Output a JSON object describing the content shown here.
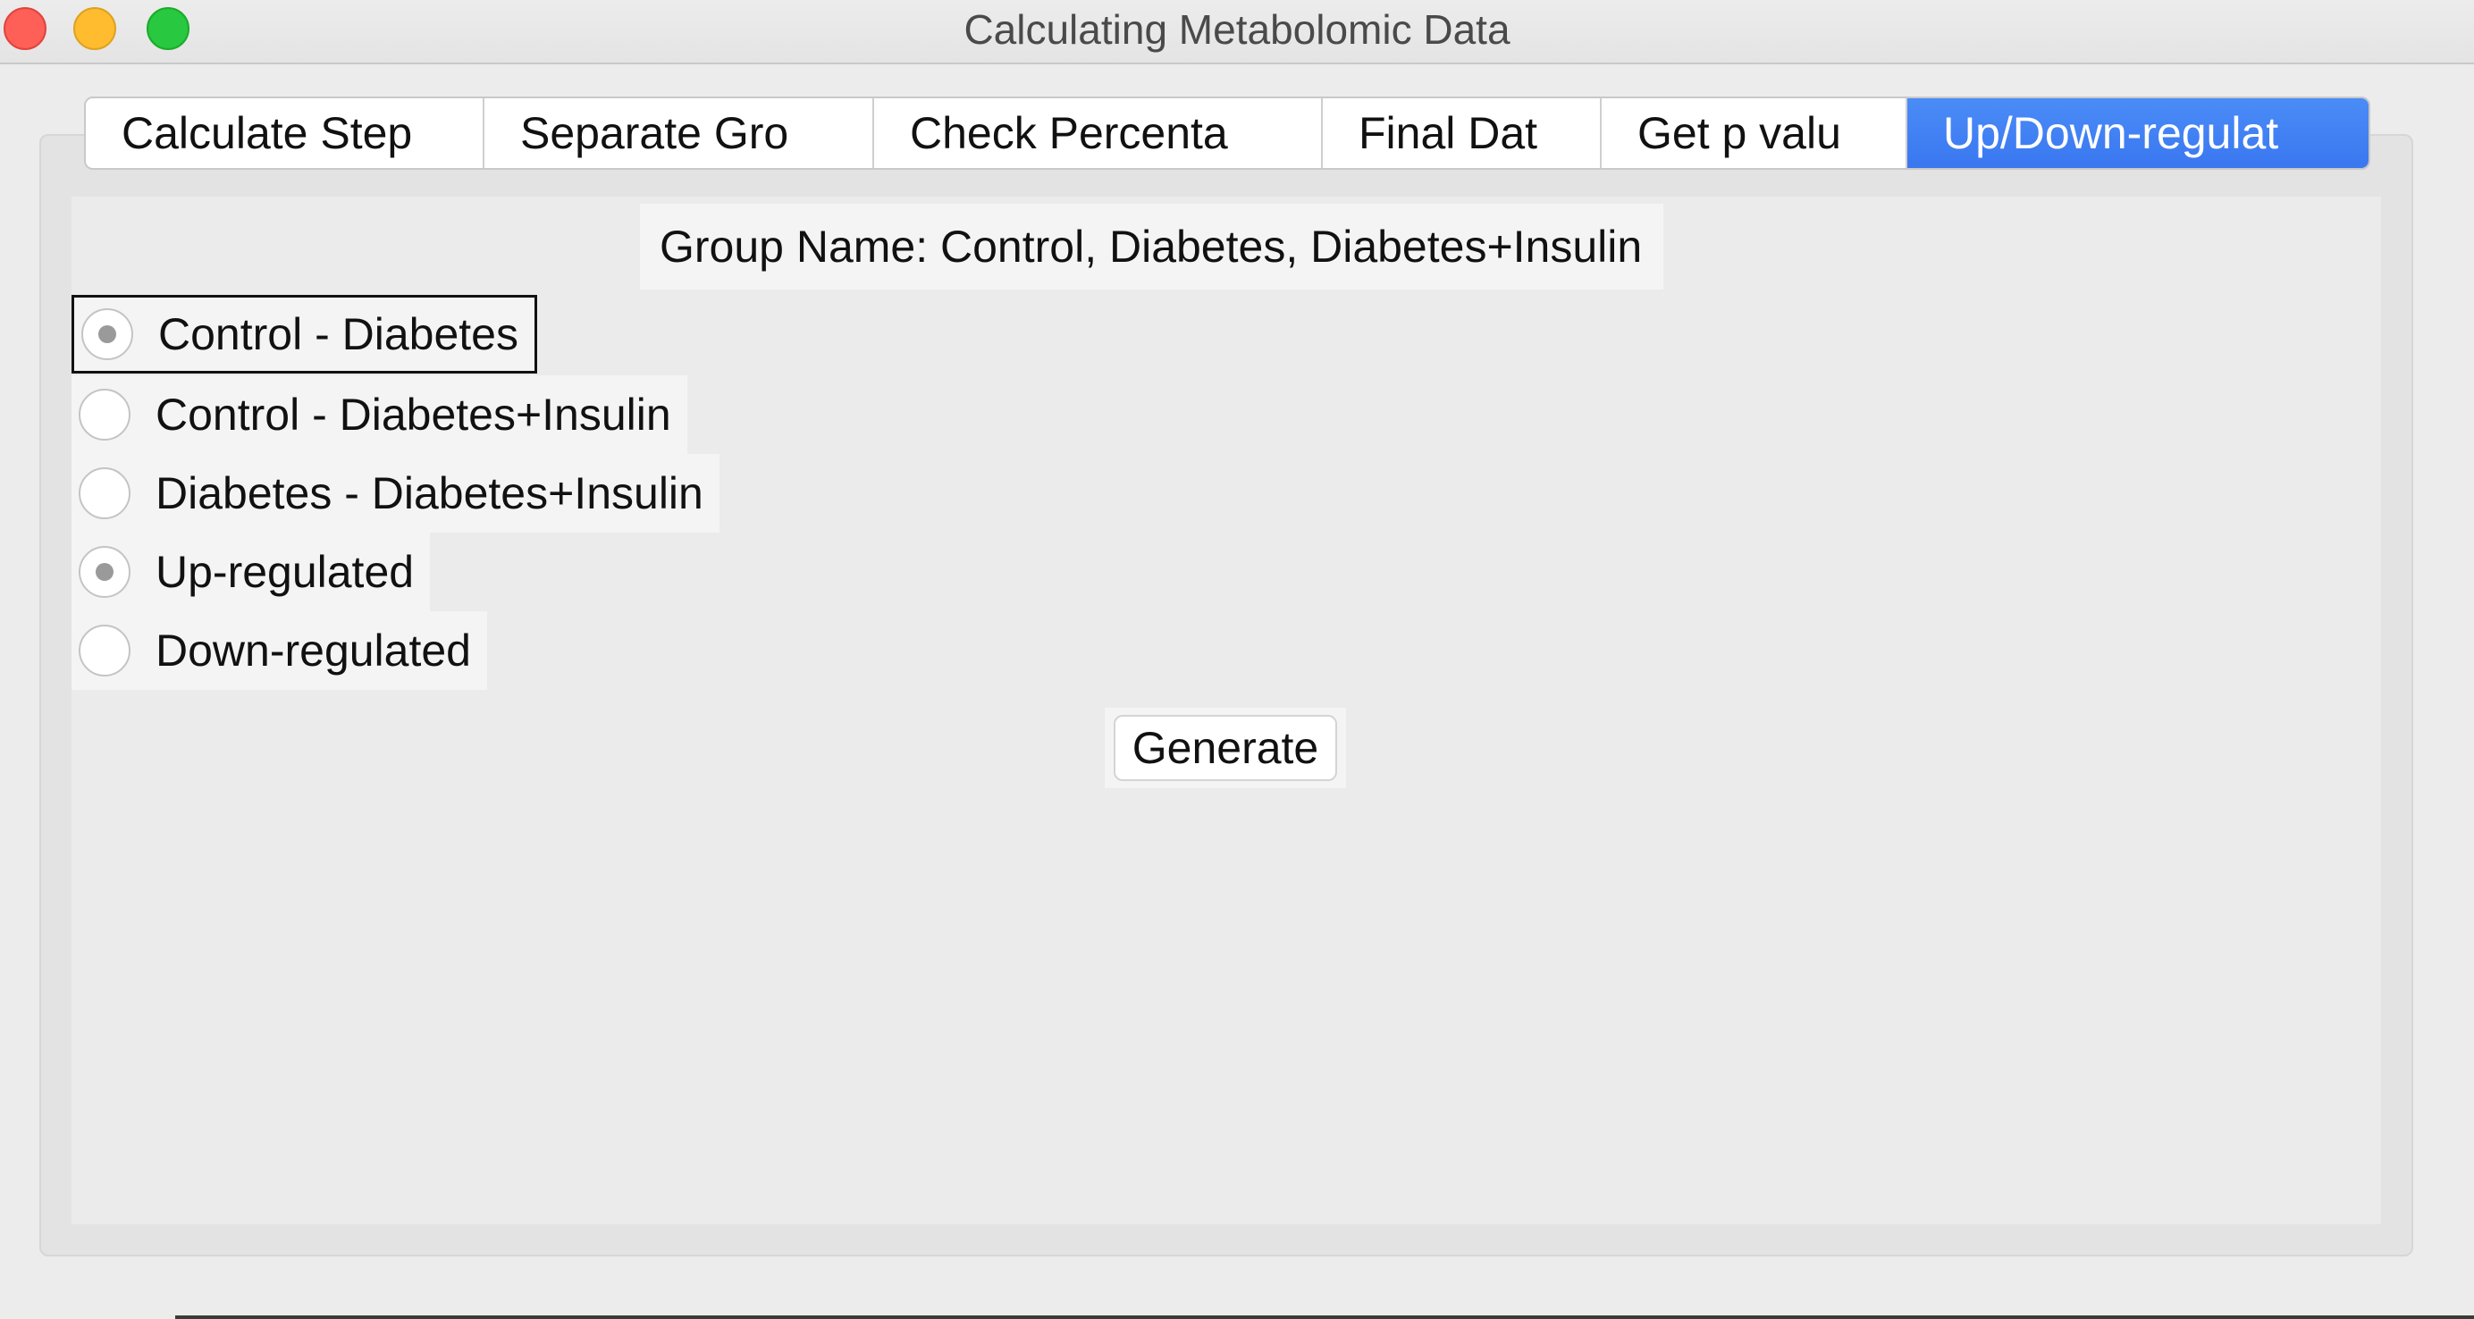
{
  "window": {
    "title": "Calculating Metabolomic Data"
  },
  "tabs": [
    {
      "label": "Calculate Step",
      "selected": false
    },
    {
      "label": "Separate Gro",
      "selected": false
    },
    {
      "label": "Check Percenta",
      "selected": false
    },
    {
      "label": "Final Dat",
      "selected": false
    },
    {
      "label": "Get p valu",
      "selected": false
    },
    {
      "label": "Up/Down-regulat",
      "selected": true
    }
  ],
  "main": {
    "group_label": "Group Name: Control, Diabetes, Diabetes+Insulin",
    "comparison_options": [
      {
        "label": "Control - Diabetes",
        "selected": true
      },
      {
        "label": "Control - Diabetes+Insulin",
        "selected": false
      },
      {
        "label": "Diabetes - Diabetes+Insulin",
        "selected": false
      }
    ],
    "regulation_options": [
      {
        "label": "Up-regulated",
        "selected": true
      },
      {
        "label": "Down-regulated",
        "selected": false
      }
    ],
    "generate_label": "Generate"
  },
  "colors": {
    "selected_tab": "#3a77f0",
    "close_button": "#fe5f57",
    "minimize_button": "#febc2e",
    "maximize_button": "#28c840"
  }
}
